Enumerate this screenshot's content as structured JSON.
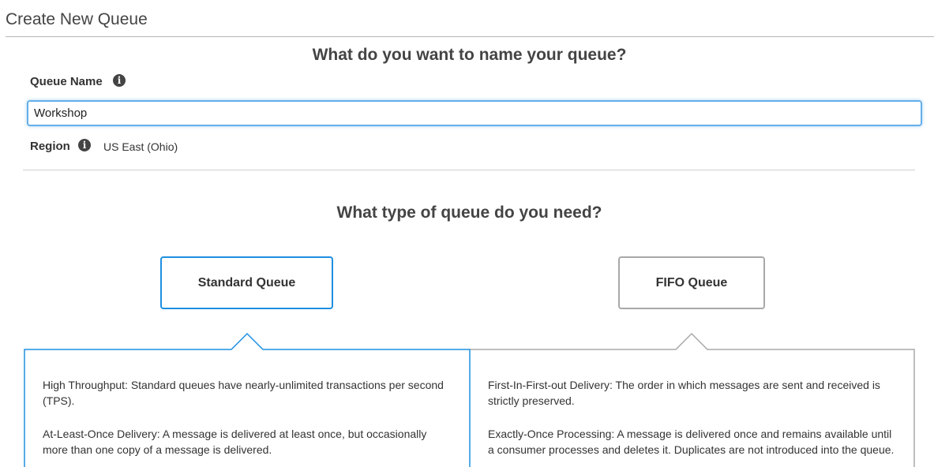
{
  "page": {
    "title": "Create New Queue"
  },
  "name_section": {
    "heading": "What do you want to name your queue?",
    "queue_name_label": "Queue Name",
    "queue_name_value": "Workshop",
    "region_label": "Region",
    "region_value": "US East (Ohio)",
    "info_icon": "info-circle-icon"
  },
  "type_section": {
    "heading": "What type of queue do you need?",
    "selected": "standard",
    "options": [
      {
        "id": "standard",
        "label": "Standard Queue",
        "descriptions": [
          "High Throughput: Standard queues have nearly-unlimited transactions per second (TPS).",
          "At-Least-Once Delivery: A message is delivered at least once, but occasionally more than one copy of a message is delivered."
        ]
      },
      {
        "id": "fifo",
        "label": "FIFO Queue",
        "descriptions": [
          "First-In-First-out Delivery: The order in which messages are sent and received is strictly preserved.",
          "Exactly-Once Processing: A message is delivered once and remains available until a consumer processes and deletes it. Duplicates are not introduced into the queue."
        ]
      }
    ]
  },
  "colors": {
    "selected_border": "#1d8fe1",
    "unselected_border": "#a8a8a8",
    "input_focus": "#66afe9"
  }
}
